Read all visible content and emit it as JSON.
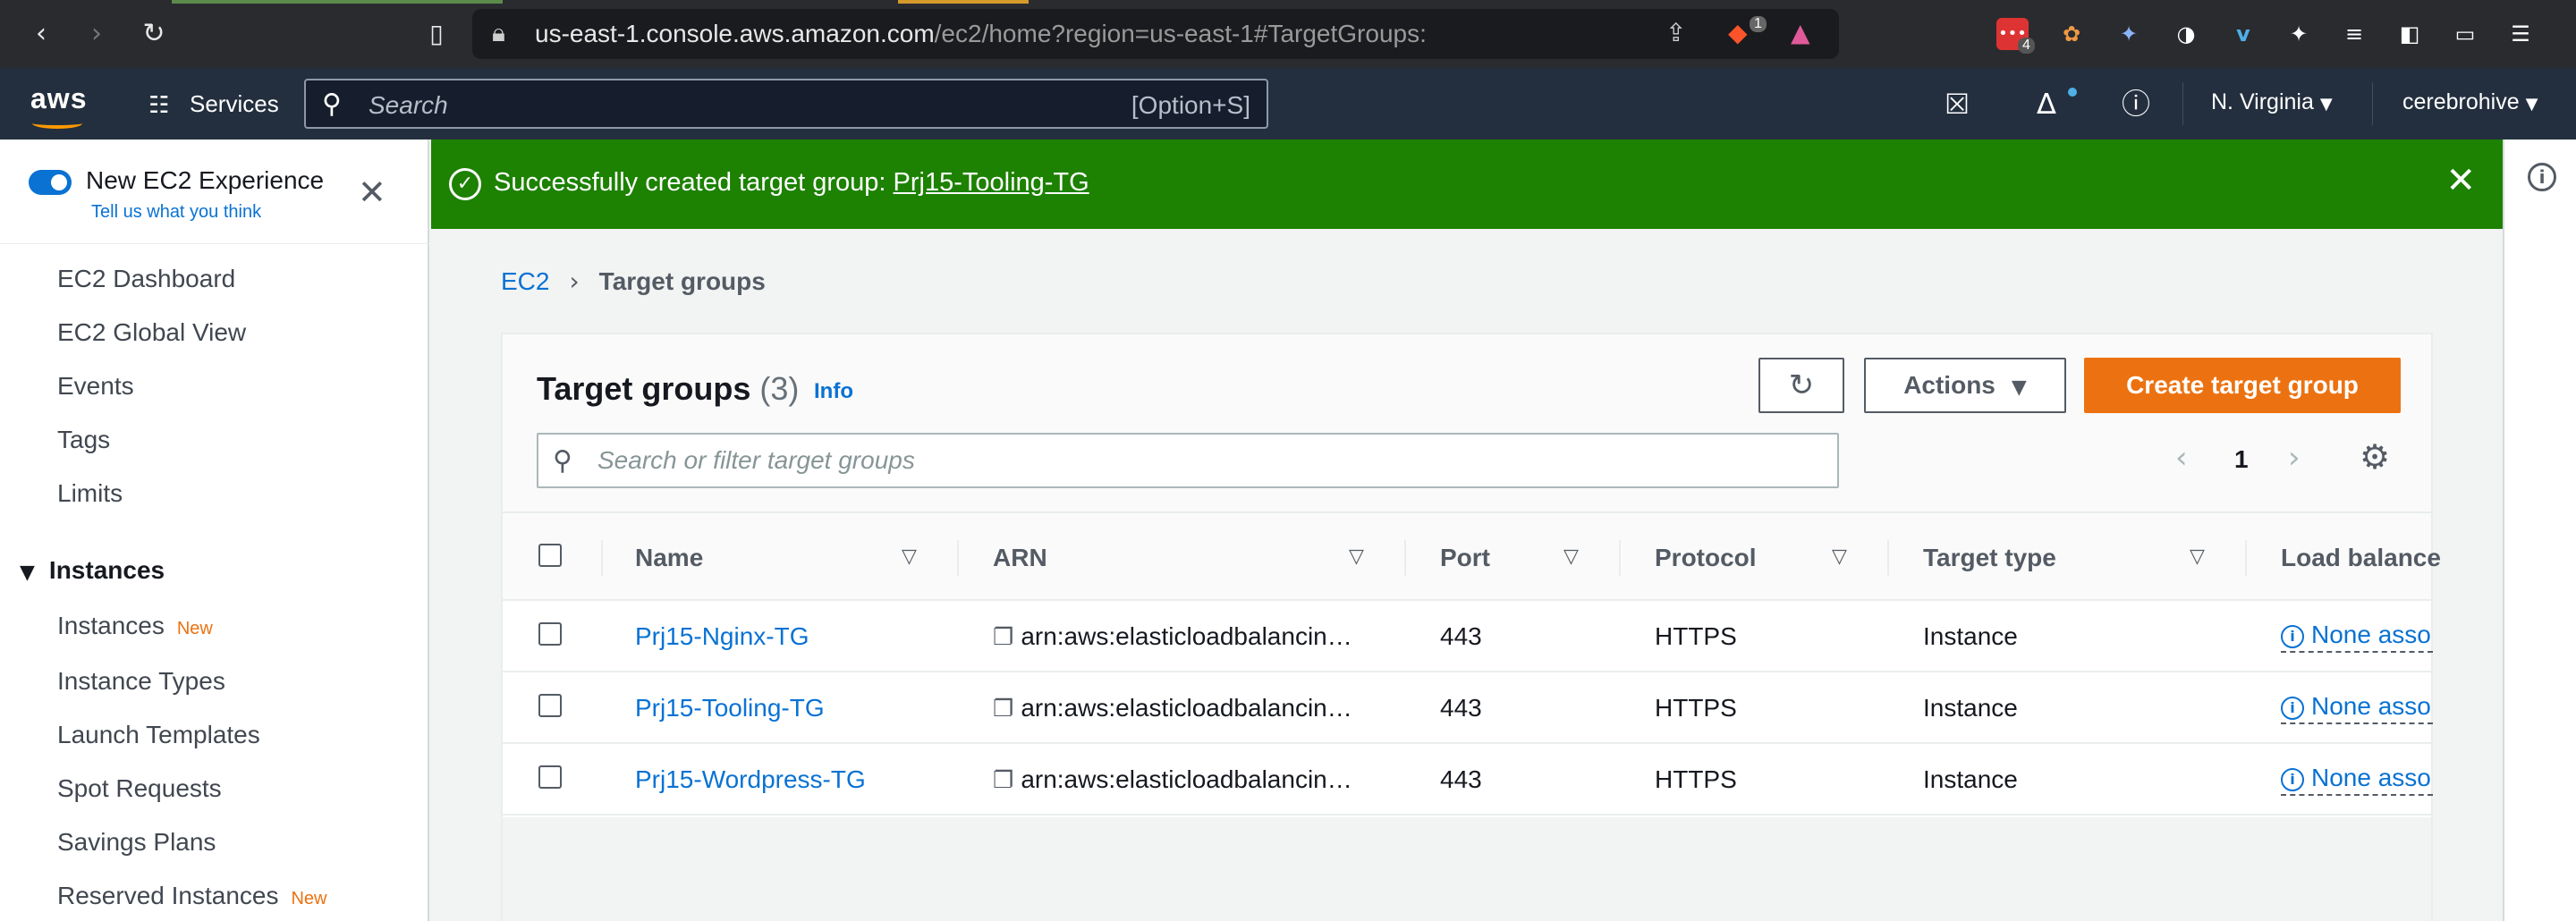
{
  "browser": {
    "url_host": "us-east-1.console.aws.amazon.com",
    "url_path": "/ec2/home?region=us-east-1#TargetGroups:",
    "brave_badge": "1",
    "ext_badge": "4"
  },
  "topnav": {
    "logo": "aws",
    "services_label": "Services",
    "search_placeholder": "Search",
    "search_shortcut": "[Option+S]",
    "region_label": "N. Virginia",
    "account_label": "cerebrohive"
  },
  "sidebar": {
    "toggle_label": "New EC2 Experience",
    "feedback_link": "Tell us what you think",
    "items_top": [
      {
        "label": "EC2 Dashboard"
      },
      {
        "label": "EC2 Global View"
      },
      {
        "label": "Events"
      },
      {
        "label": "Tags"
      },
      {
        "label": "Limits"
      }
    ],
    "section_label": "Instances",
    "section_items": [
      {
        "label": "Instances",
        "badge": "New"
      },
      {
        "label": "Instance Types"
      },
      {
        "label": "Launch Templates"
      },
      {
        "label": "Spot Requests"
      },
      {
        "label": "Savings Plans"
      },
      {
        "label": "Reserved Instances",
        "badge": "New"
      }
    ]
  },
  "flash": {
    "message": "Successfully created target group: ",
    "link": "Prj15-Tooling-TG"
  },
  "breadcrumb": {
    "root": "EC2",
    "current": "Target groups"
  },
  "panel": {
    "title": "Target groups",
    "count": "(3)",
    "info": "Info",
    "actions_label": "Actions",
    "create_label": "Create target group",
    "filter_placeholder": "Search or filter target groups",
    "page": "1"
  },
  "table": {
    "columns": [
      "Name",
      "ARN",
      "Port",
      "Protocol",
      "Target type",
      "Load balance"
    ],
    "rows": [
      {
        "name": "Prj15-Nginx-TG",
        "arn": "arn:aws:elasticloadbalancin…",
        "port": "443",
        "protocol": "HTTPS",
        "target_type": "Instance",
        "load_balancer": "None asso"
      },
      {
        "name": "Prj15-Tooling-TG",
        "arn": "arn:aws:elasticloadbalancin…",
        "port": "443",
        "protocol": "HTTPS",
        "target_type": "Instance",
        "load_balancer": "None asso"
      },
      {
        "name": "Prj15-Wordpress-TG",
        "arn": "arn:aws:elasticloadbalancin…",
        "port": "443",
        "protocol": "HTTPS",
        "target_type": "Instance",
        "load_balancer": "None asso"
      }
    ]
  },
  "colors": {
    "aws_nav": "#232f3e",
    "success": "#1d8102",
    "primary_button": "#ec7211",
    "link": "#0972d3"
  }
}
